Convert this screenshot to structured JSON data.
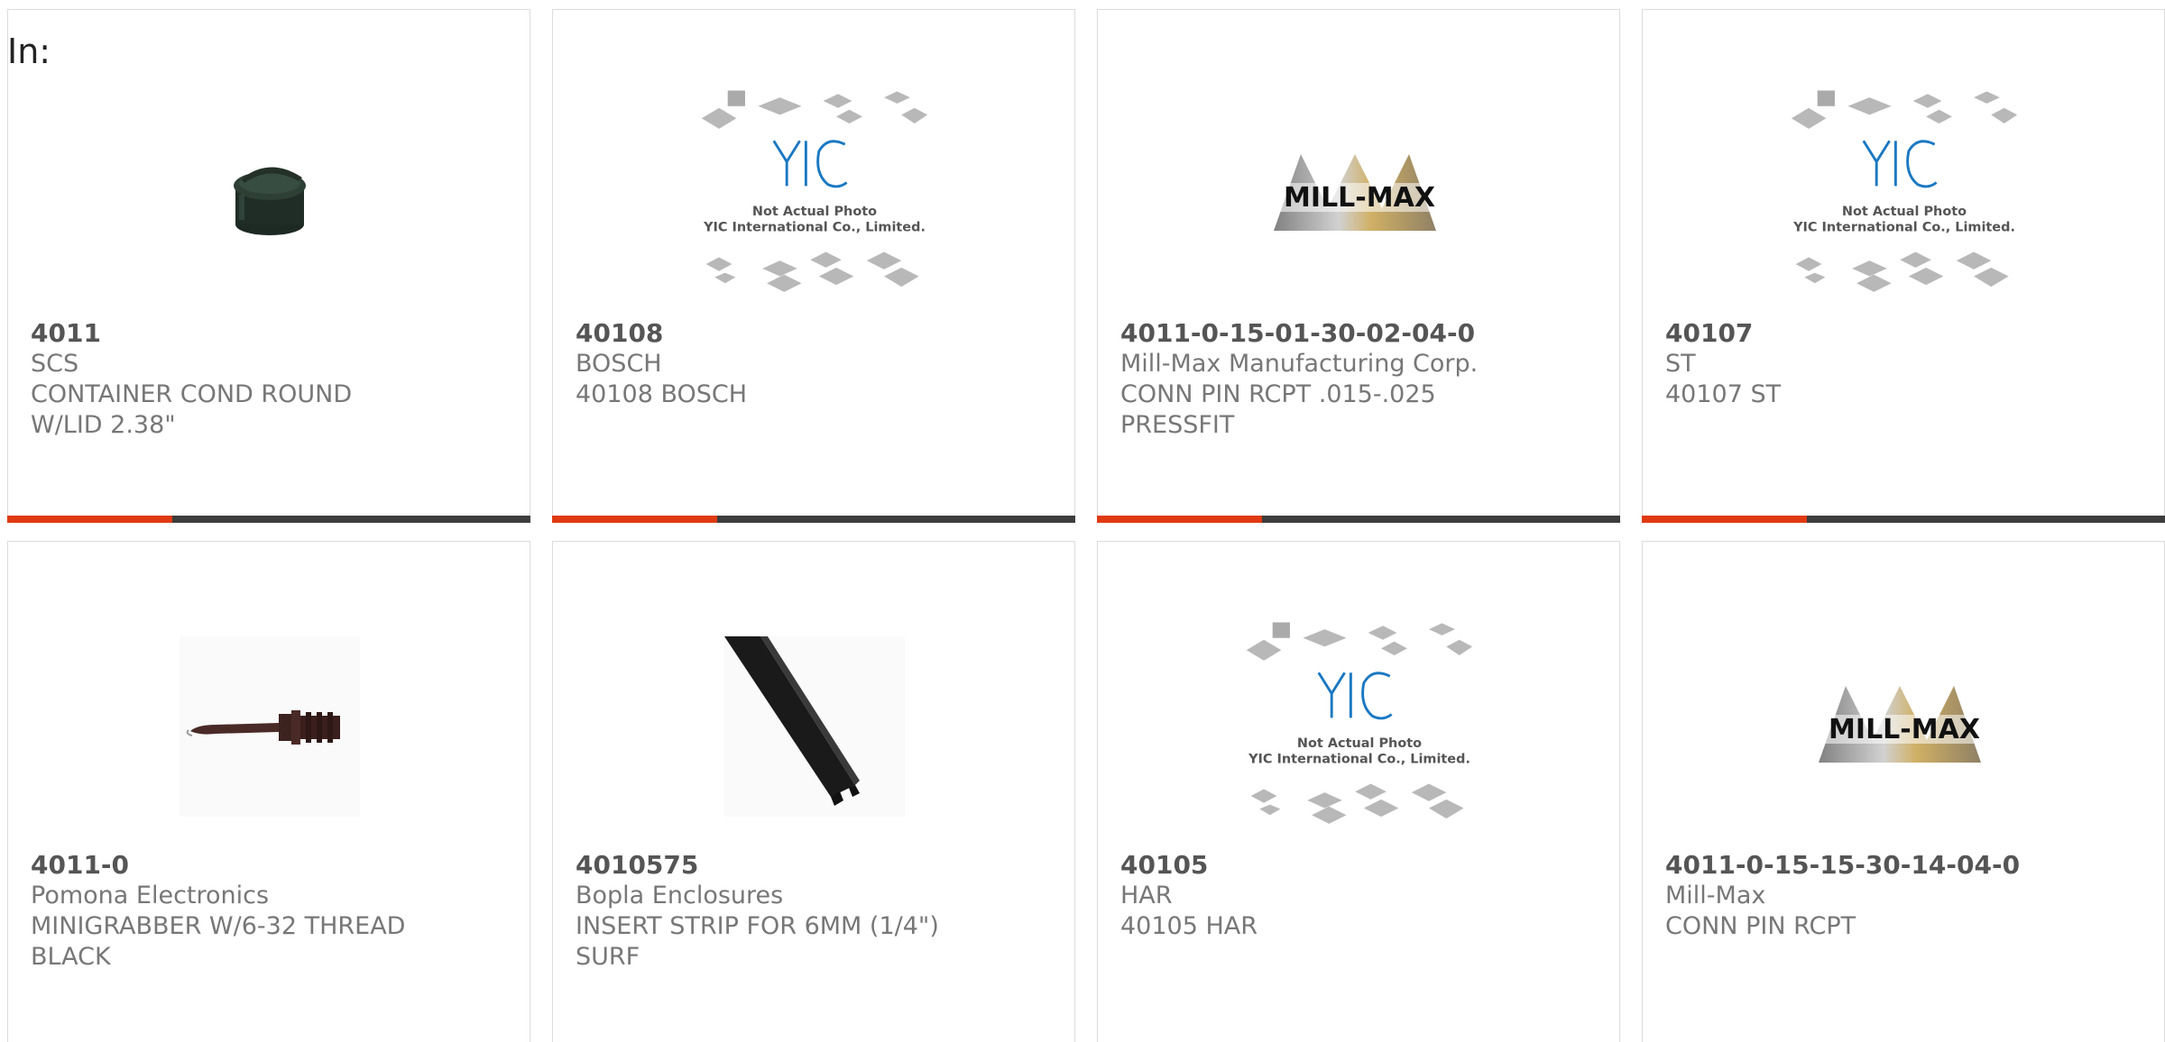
{
  "header": {
    "in_label": "In:"
  },
  "colors": {
    "accent": "#e03a12",
    "bar": "#3d3d3d",
    "border": "#dcdcdc",
    "part_number": "#555555",
    "text": "#777777"
  },
  "products": [
    {
      "part_number": "4011",
      "manufacturer": "SCS",
      "description_lines": [
        "CONTAINER COND ROUND",
        "W/LID 2.38\""
      ],
      "image": "black-container-photo"
    },
    {
      "part_number": "40108",
      "manufacturer": "BOSCH",
      "description_lines": [
        "40108 BOSCH"
      ],
      "image": "yic-placeholder",
      "image_text": [
        "Not Actual Photo",
        "YIC International Co., Limited."
      ]
    },
    {
      "part_number": "4011-0-15-01-30-02-04-0",
      "manufacturer": "Mill-Max Manufacturing Corp.",
      "description_lines": [
        "CONN PIN RCPT .015-.025",
        "PRESSFIT"
      ],
      "image": "mill-max-logo",
      "image_text": [
        "MILL-MAX"
      ]
    },
    {
      "part_number": "40107",
      "manufacturer": "ST",
      "description_lines": [
        "40107 ST"
      ],
      "image": "yic-placeholder",
      "image_text": [
        "Not Actual Photo",
        "YIC International Co., Limited."
      ]
    },
    {
      "part_number": "4011-0",
      "manufacturer": "Pomona Electronics",
      "description_lines": [
        "MINIGRABBER W/6-32 THREAD",
        "BLACK"
      ],
      "image": "minigrabber-photo"
    },
    {
      "part_number": "4010575",
      "manufacturer": "Bopla Enclosures",
      "description_lines": [
        "INSERT STRIP FOR 6MM (1/4\")",
        "SURF"
      ],
      "image": "insert-strip-photo"
    },
    {
      "part_number": "40105",
      "manufacturer": "HAR",
      "description_lines": [
        "40105 HAR"
      ],
      "image": "yic-placeholder",
      "image_text": [
        "Not Actual Photo",
        "YIC International Co., Limited."
      ]
    },
    {
      "part_number": "4011-0-15-15-30-14-04-0",
      "manufacturer": "Mill-Max",
      "description_lines": [
        "CONN PIN RCPT"
      ],
      "image": "mill-max-logo",
      "image_text": [
        "MILL-MAX"
      ]
    }
  ]
}
